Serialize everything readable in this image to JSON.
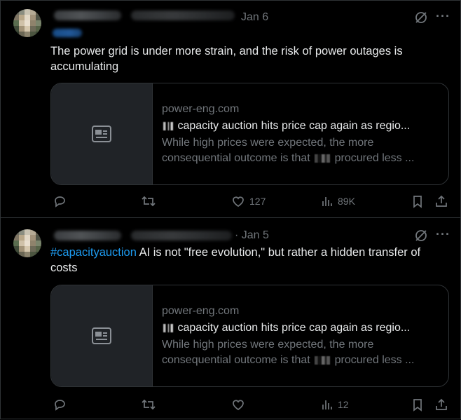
{
  "tweets": [
    {
      "date": "Jan 6",
      "text": " The power grid is under more strain, and the risk of power outages is accumulating",
      "card": {
        "domain": "power-eng.com",
        "title_rest": "capacity auction hits price cap again as regio...",
        "desc_a": "While high prices were expected, the more consequential outcome is that",
        "desc_b": "procured less ..."
      },
      "stats": {
        "likes": "127",
        "views": "89K"
      }
    },
    {
      "date": "· Jan 5",
      "hashtag": "#capacityauction",
      "text": " AI is not \"free evolution,\" but rather a hidden transfer of costs",
      "card": {
        "domain": "power-eng.com",
        "title_rest": "capacity auction hits price cap again as regio...",
        "desc_a": "While high prices were expected, the more consequential outcome is that",
        "desc_b": "procured less ..."
      },
      "stats": {
        "likes": "",
        "views": "12"
      }
    }
  ],
  "icons": {
    "reply": "reply-icon",
    "retweet": "retweet-icon",
    "like": "heart-icon",
    "views": "views-icon",
    "bookmark": "bookmark-icon",
    "share": "share-icon",
    "grok": "grok-icon",
    "more": "more-icon",
    "card_thumb": "article-icon"
  },
  "colors": {
    "background": "#000000",
    "text": "#e7e9ea",
    "muted": "#71767b",
    "hashtag": "#1d9bf0",
    "border": "#2f3336"
  }
}
